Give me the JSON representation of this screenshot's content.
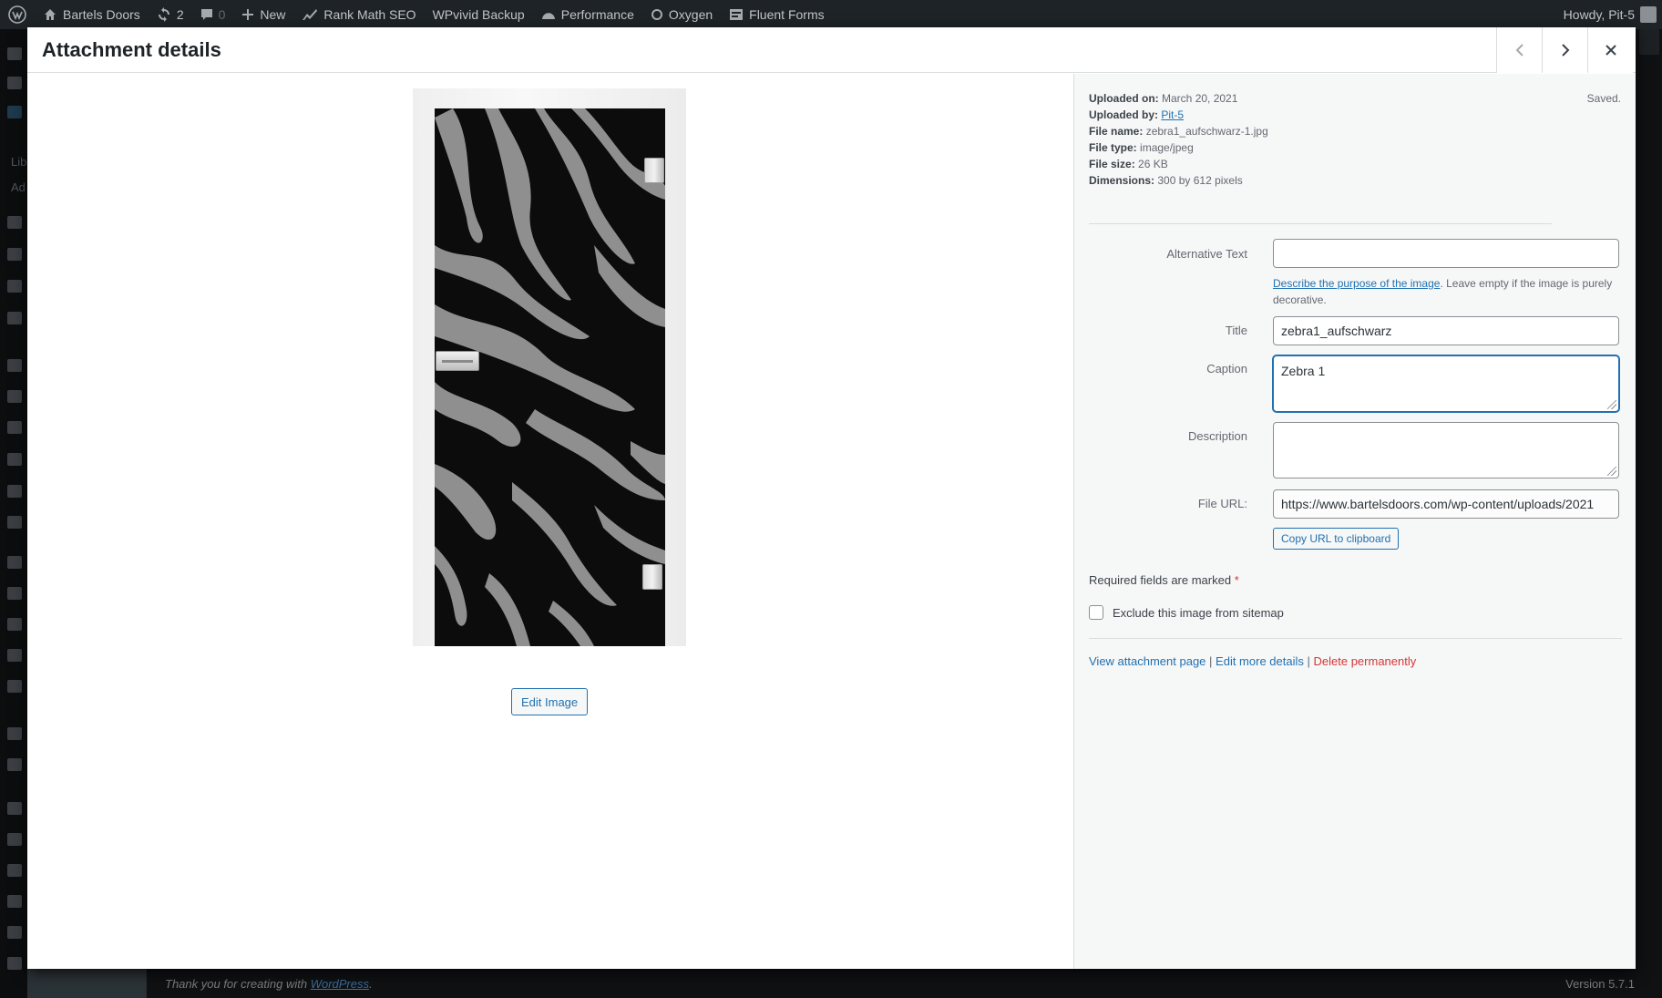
{
  "admin_bar": {
    "site_name": "Bartels Doors",
    "updates_count": "2",
    "comments_count": "0",
    "new_label": "New",
    "rank_math_label": "Rank Math SEO",
    "wpvivid_label": "WPvivid Backup",
    "performance_label": "Performance",
    "oxygen_label": "Oxygen",
    "fluent_forms_label": "Fluent Forms",
    "howdy": "Howdy, Pit-5"
  },
  "admin_menu": {
    "library_label_partial": "Lib",
    "add_new_partial": "Ad"
  },
  "footer": {
    "thanks_text": "Thank you for creating with ",
    "wordpress_link": "WordPress",
    "thanks_end": ".",
    "version": "Version 5.7.1"
  },
  "modal": {
    "title": "Attachment details",
    "edit_image_label": "Edit Image"
  },
  "details": {
    "saved_label": "Saved.",
    "meta": {
      "uploaded_on_label": "Uploaded on:",
      "uploaded_on": "March 20, 2021",
      "uploaded_by_label": "Uploaded by:",
      "uploaded_by": "Pit-5",
      "file_name_label": "File name:",
      "file_name": "zebra1_aufschwarz-1.jpg",
      "file_type_label": "File type:",
      "file_type": "image/jpeg",
      "file_size_label": "File size:",
      "file_size": "26 KB",
      "dimensions_label": "Dimensions:",
      "dimensions": "300 by 612 pixels"
    },
    "fields": {
      "alt_label": "Alternative Text",
      "alt_value": "",
      "alt_help_link": "Describe the purpose of the image",
      "alt_help_rest": ". Leave empty if the image is purely decorative.",
      "title_label": "Title",
      "title_value": "zebra1_aufschwarz",
      "caption_label": "Caption",
      "caption_value": "Zebra 1",
      "description_label": "Description",
      "description_value": "",
      "file_url_label": "File URL:",
      "file_url_value": "https://www.bartelsdoors.com/wp-content/uploads/2021",
      "copy_url_label": "Copy URL to clipboard"
    },
    "required_note": "Required fields are marked",
    "required_star": "*",
    "sitemap_label": "Exclude this image from sitemap",
    "actions": {
      "view_page": "View attachment page",
      "edit_more": "Edit more details",
      "delete": "Delete permanently",
      "separator": "|"
    }
  },
  "colors": {
    "accent": "#2271b1",
    "danger": "#d63638",
    "admin_bar_bg": "#1d2327"
  }
}
